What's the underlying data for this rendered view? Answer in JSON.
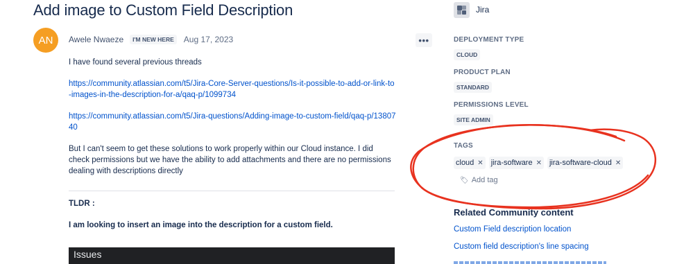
{
  "post": {
    "title": "Add image to Custom Field Description",
    "avatar_initials": "AN",
    "author": "Awele Nwaeze",
    "badge": "I'M NEW HERE",
    "date": "Aug 17, 2023",
    "more_label": "•••",
    "body": {
      "p1": "I have found several previous threads",
      "link1": "https://community.atlassian.com/t5/Jira-Core-Server-questions/Is-it-possible-to-add-or-link-to-images-in-the-description-for-a/qaq-p/1099734",
      "link2": "https://community.atlassian.com/t5/Jira-questions/Adding-image-to-custom-field/qaq-p/1380740",
      "p2": "But I can't seem to get these solutions to work properly within our Cloud instance. I did check permissions but we have the ability to add attachments and there are no permissions dealing with descriptions directly"
    },
    "tldr_label": "TLDR :",
    "tldr_text": "I am looking to insert an image into the description for a custom field.",
    "embedded_panel_label": "Issues"
  },
  "sidebar": {
    "product": "Jira",
    "deployment_type_label": "DEPLOYMENT TYPE",
    "deployment_type": "CLOUD",
    "product_plan_label": "PRODUCT PLAN",
    "product_plan": "STANDARD",
    "permissions_label": "PERMISSIONS LEVEL",
    "permissions": "SITE ADMIN",
    "tags_label": "TAGS",
    "tags": [
      "cloud",
      "jira-software",
      "jira-software-cloud"
    ],
    "add_tag": "Add tag",
    "related_title": "Related Community content",
    "related_links": [
      "Custom Field description location",
      "Custom field description's line spacing"
    ]
  },
  "colors": {
    "avatar": "#f59e23",
    "link": "#0052cc",
    "annotation": "#e8321f"
  }
}
